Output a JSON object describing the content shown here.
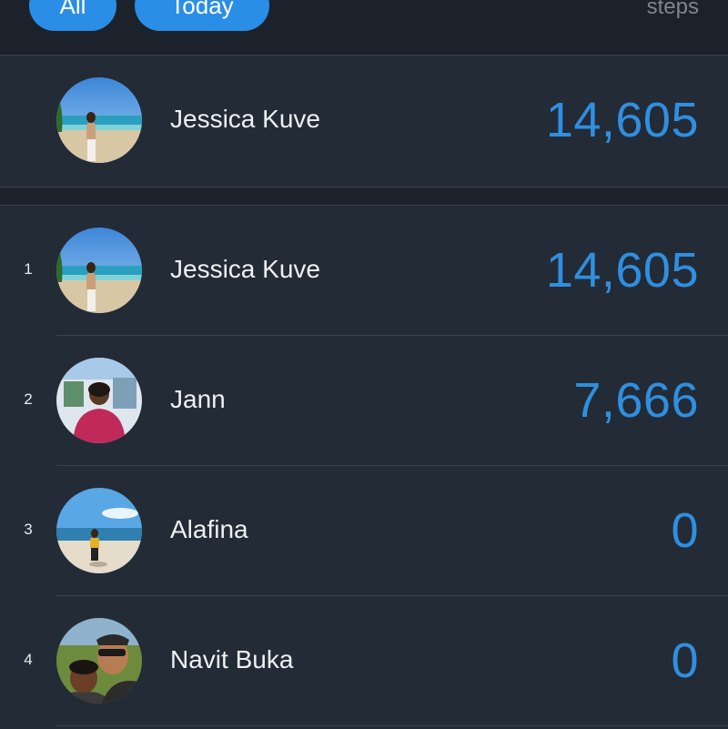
{
  "header": {
    "filters": [
      {
        "label": "All",
        "active": true
      },
      {
        "label": "Today",
        "active": true
      }
    ],
    "unit_label": "steps"
  },
  "current_user": {
    "name": "Jessica Kuve",
    "value": "14,605",
    "avatar_icon": "beach-portrait-avatar"
  },
  "leaderboard": [
    {
      "rank": "1",
      "name": "Jessica Kuve",
      "value": "14,605",
      "avatar_icon": "beach-portrait-avatar"
    },
    {
      "rank": "2",
      "name": "Jann",
      "value": "7,666",
      "avatar_icon": "indoor-portrait-avatar"
    },
    {
      "rank": "3",
      "name": "Alafina",
      "value": "0",
      "avatar_icon": "beach-fullbody-avatar"
    },
    {
      "rank": "4",
      "name": "Navit Buka",
      "value": "0",
      "avatar_icon": "couple-selfie-avatar"
    }
  ],
  "colors": {
    "accent": "#2f8fe0",
    "pill": "#2a8ee6",
    "background": "#232b36",
    "header_background": "#1b222c",
    "divider": "#39424e",
    "muted_text": "#7d8691"
  }
}
